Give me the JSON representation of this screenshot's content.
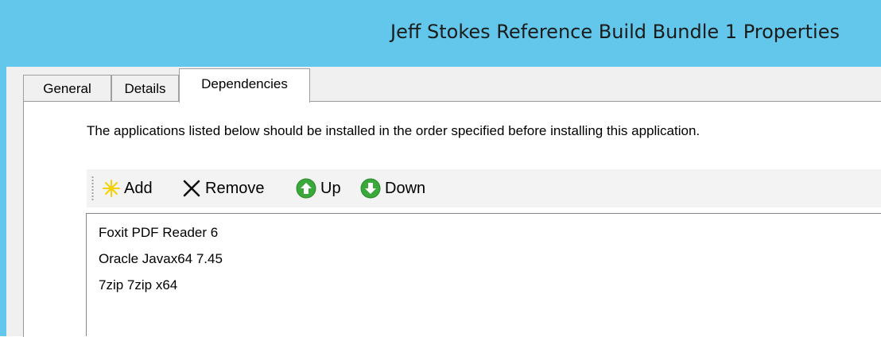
{
  "window": {
    "title": "Jeff Stokes Reference Build Bundle 1 Properties"
  },
  "tabs": [
    {
      "label": "General",
      "active": false
    },
    {
      "label": "Details",
      "active": false
    },
    {
      "label": "Dependencies",
      "active": true
    }
  ],
  "dependencies": {
    "description": "The applications listed below should be installed in the order specified before installing this application.",
    "toolbar": {
      "add_label": "Add",
      "remove_label": "Remove",
      "up_label": "Up",
      "down_label": "Down"
    },
    "items": [
      "Foxit PDF Reader 6",
      "Oracle Javax64 7.45",
      "7zip 7zip x64"
    ]
  },
  "colors": {
    "titlebar": "#62c7ea",
    "dialog_background": "#f0f0f0",
    "arrow_green": "#3aa83a",
    "add_star_yellow": "#f5d000"
  },
  "icons": {
    "add": "add-star-icon",
    "remove": "remove-x-icon",
    "up": "up-arrow-icon",
    "down": "down-arrow-icon"
  }
}
